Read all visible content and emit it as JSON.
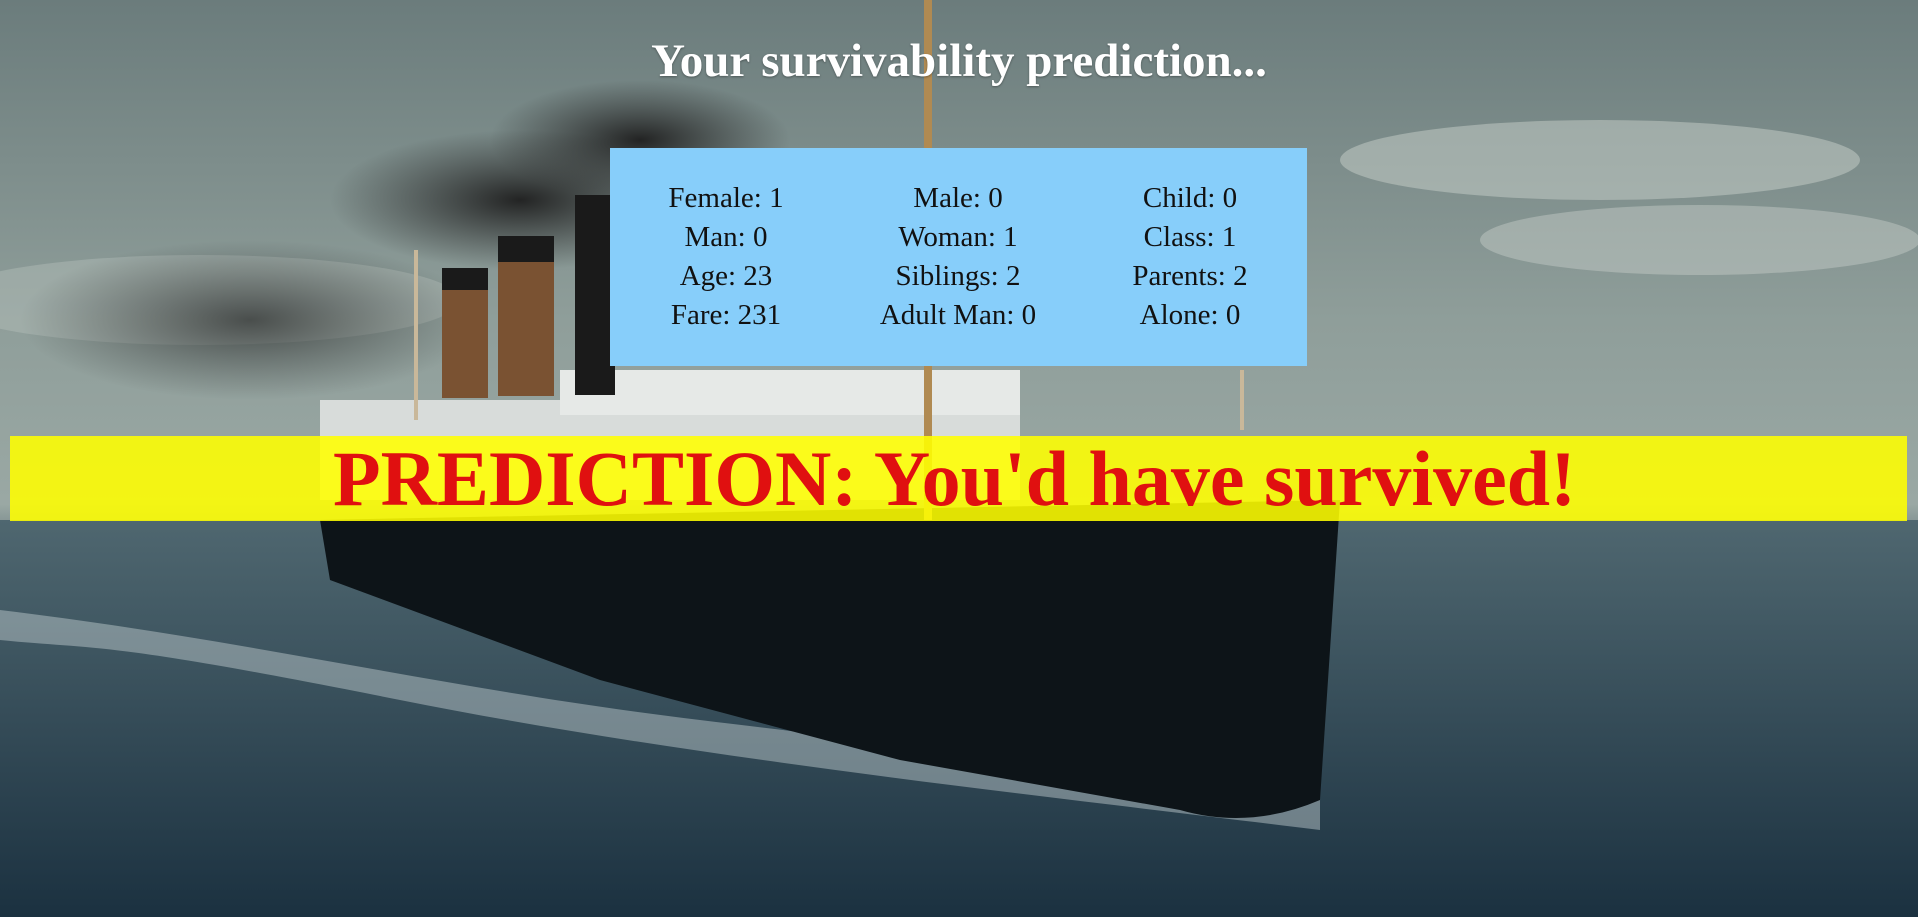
{
  "page": {
    "title": "Your survivability prediction..."
  },
  "features": {
    "female": "Female: 1",
    "male": "Male: 0",
    "child": "Child: 0",
    "man": "Man: 0",
    "woman": "Woman: 1",
    "class": "Class: 1",
    "age": "Age: 23",
    "siblings": "Siblings: 2",
    "parents": "Parents: 2",
    "fare": "Fare: 231",
    "adult_man": "Adult Man: 0",
    "alone": "Alone: 0"
  },
  "prediction": {
    "text": "PREDICTION: You'd have survived!"
  },
  "colors": {
    "info_box": "#87cefa",
    "banner": "#ffff00",
    "prediction_text": "#e01010",
    "title_text": "#ffffff"
  }
}
